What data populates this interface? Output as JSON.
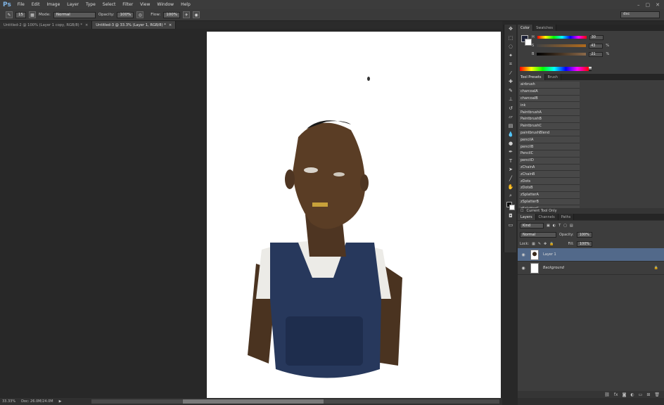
{
  "menubar": {
    "logo": "Ps",
    "items": [
      "File",
      "Edit",
      "Image",
      "Layer",
      "Type",
      "Select",
      "Filter",
      "View",
      "Window",
      "Help"
    ]
  },
  "options": {
    "brush_size": "15",
    "mode_label": "Mode:",
    "mode_value": "Normal",
    "opacity_label": "Opacity:",
    "opacity_value": "100%",
    "flow_label": "Flow:",
    "flow_value": "100%",
    "workspace": "dsc"
  },
  "tabs": [
    {
      "label": "Untitled-2 @ 100% (Layer 1 copy, RGB/8) *",
      "active": false
    },
    {
      "label": "Untitled-3 @ 33.3% (Layer 1, RGB/8) *",
      "active": true
    }
  ],
  "status": {
    "zoom": "33.33%",
    "doc": "Doc: 26.0M/24.0M"
  },
  "color_panel": {
    "tabs": [
      "Color",
      "Swatches"
    ],
    "channels": [
      {
        "label": "H",
        "value": "30",
        "unit": ""
      },
      {
        "label": "S",
        "value": "43",
        "unit": "%"
      },
      {
        "label": "B",
        "value": "21",
        "unit": "%"
      }
    ],
    "fg_color": "#1d2238",
    "bg_color": "#ffffff"
  },
  "presets_panel": {
    "tabs": [
      "Tool Presets",
      "Brush"
    ],
    "items": [
      "airbrush",
      "charcoalA",
      "charcoalB",
      "ink",
      "PaintbrushA",
      "PaintbrushB",
      "PaintbrushC",
      "paintbrushBlend",
      "pencilA",
      "pencilB",
      "PencilC",
      "pencilD",
      "zChainA",
      "zChainB",
      "zDots",
      "zDotsB",
      "zSplatterA",
      "zSplatterB",
      "zSplatterC"
    ],
    "current_only": "Current Tool Only"
  },
  "layers_panel": {
    "tabs": [
      "Layers",
      "Channels",
      "Paths"
    ],
    "kind": "Kind",
    "blend": "Normal",
    "opacity_label": "Opacity:",
    "opacity": "100%",
    "lock_label": "Lock:",
    "fill_label": "Fill:",
    "fill": "100%",
    "layers": [
      {
        "name": "Layer 1",
        "selected": true
      },
      {
        "name": "Background",
        "selected": false
      }
    ]
  },
  "icons": {
    "tools": [
      "move-icon",
      "marquee-icon",
      "lasso-icon",
      "quick-select-icon",
      "crop-icon",
      "eyedropper-icon",
      "healing-icon",
      "brush-icon",
      "stamp-icon",
      "history-brush-icon",
      "eraser-icon",
      "gradient-icon",
      "blur-icon",
      "dodge-icon",
      "pen-icon",
      "type-icon",
      "path-select-icon",
      "shape-icon",
      "hand-icon",
      "zoom-icon"
    ]
  }
}
